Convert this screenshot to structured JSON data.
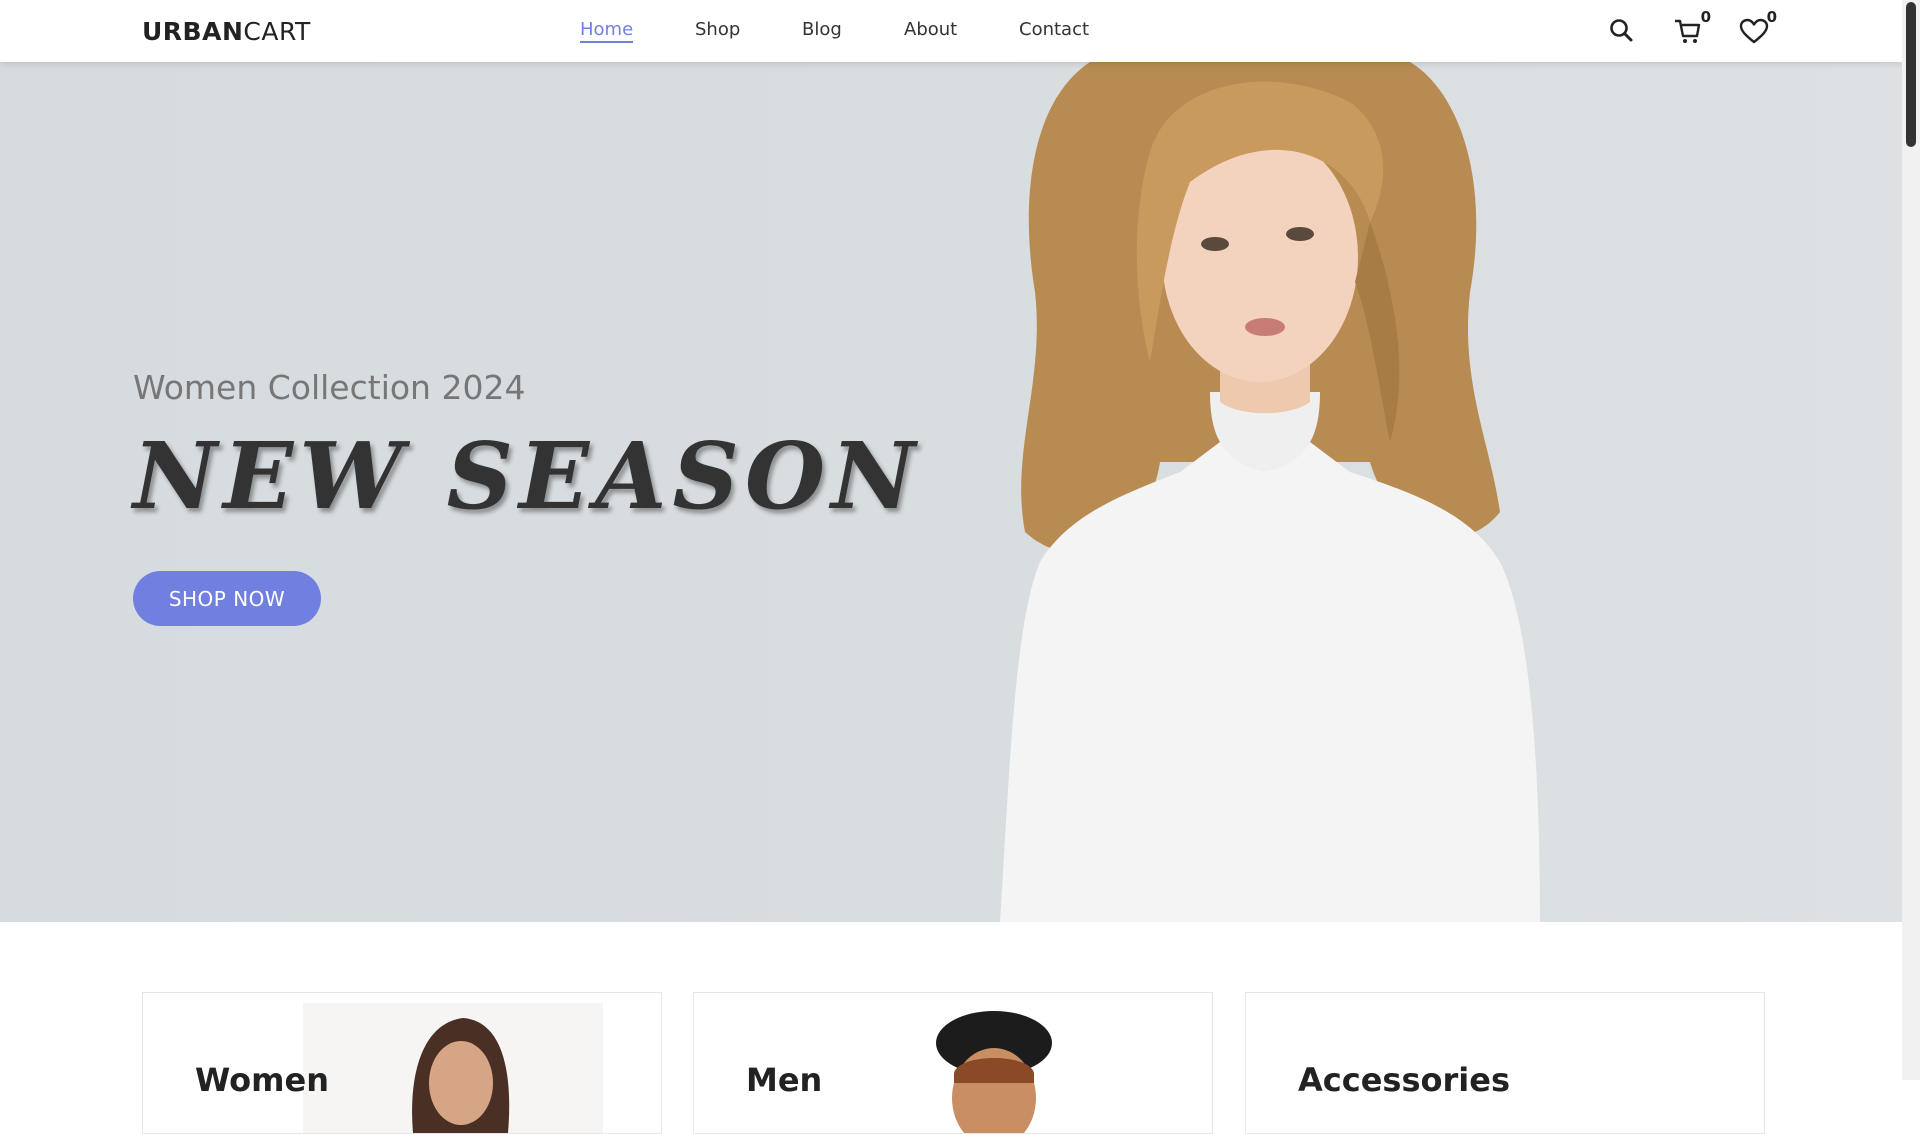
{
  "header": {
    "logo_bold": "URBAN",
    "logo_rest": "CART",
    "nav": [
      {
        "label": "Home",
        "active": true
      },
      {
        "label": "Shop",
        "active": false
      },
      {
        "label": "Blog",
        "active": false
      },
      {
        "label": "About",
        "active": false
      },
      {
        "label": "Contact",
        "active": false
      }
    ],
    "cart_count": "0",
    "wishlist_count": "0"
  },
  "hero": {
    "subtitle": "Women Collection 2024",
    "title": "NEW SEASON",
    "button_label": "SHOP NOW"
  },
  "categories": [
    {
      "title": "Women"
    },
    {
      "title": "Men"
    },
    {
      "title": "Accessories"
    }
  ],
  "colors": {
    "accent": "#717fe0",
    "hero_bg": "#d8dde0",
    "text_dark": "#222222"
  },
  "icons": [
    "search-icon",
    "cart-icon",
    "heart-icon"
  ]
}
